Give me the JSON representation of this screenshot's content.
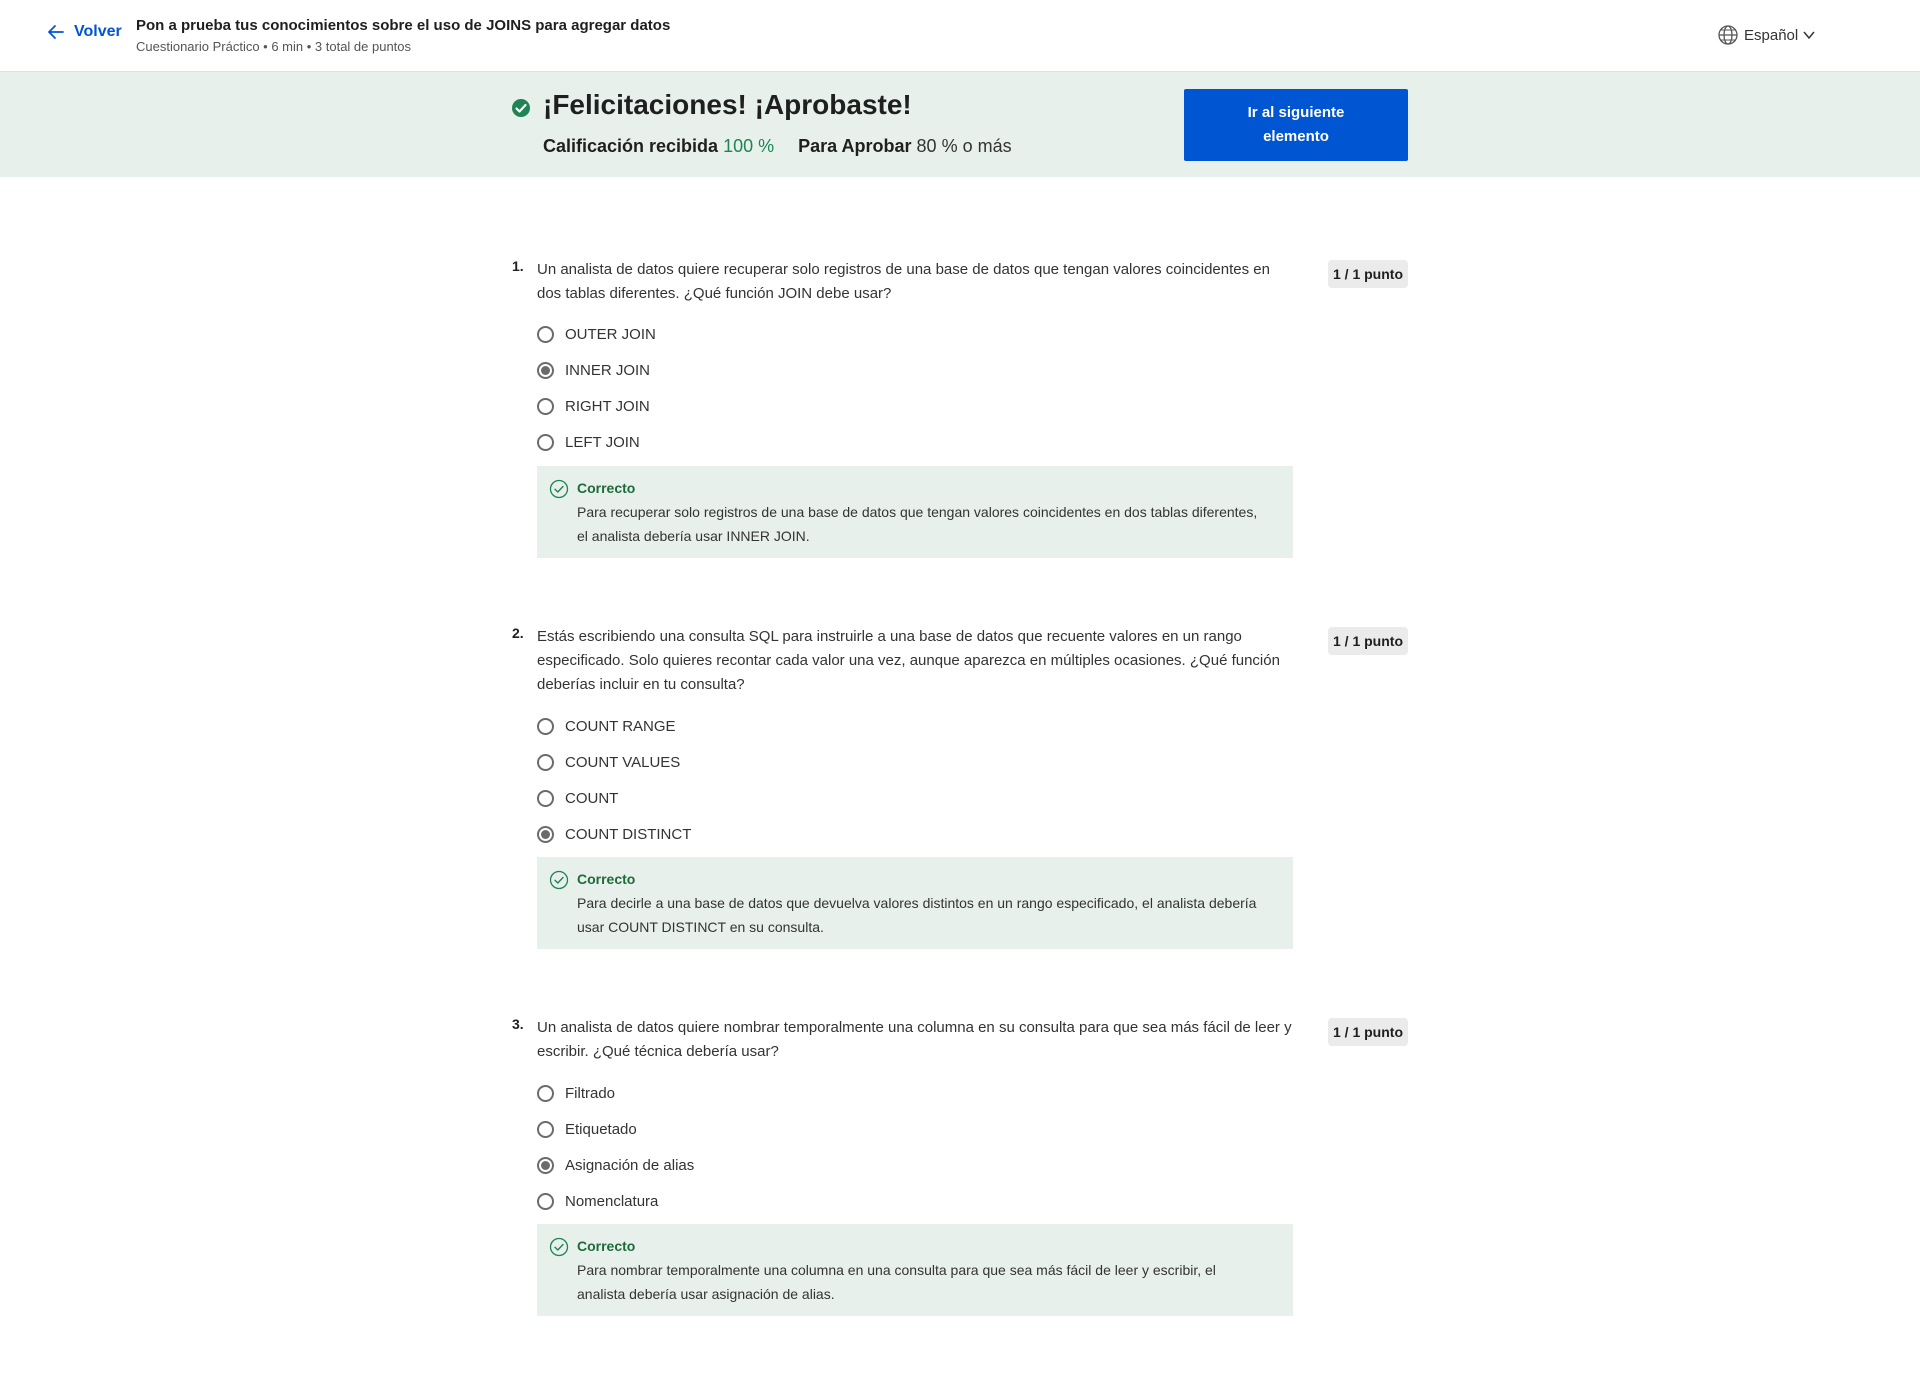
{
  "header": {
    "back_label": "Volver",
    "title": "Pon a prueba tus conocimientos sobre el uso de JOINS para agregar datos",
    "subtitle": "Cuestionario Práctico • 6 min • 3 total de puntos",
    "language": "Español"
  },
  "banner": {
    "heading": "¡Felicitaciones! ¡Aprobaste!",
    "grade_label": "Calificación recibida",
    "grade_value": "100 %",
    "pass_label": "Para Aprobar",
    "pass_value": "80 % o más",
    "next_button": "Ir al siguiente elemento"
  },
  "questions": [
    {
      "number": "1.",
      "text": "Un analista de datos quiere recuperar solo registros de una base de datos que tengan valores coincidentes en dos tablas diferentes. ¿Qué función JOIN debe usar?",
      "points": "1 / 1 punto",
      "options": [
        "OUTER JOIN",
        "INNER JOIN",
        "RIGHT JOIN",
        "LEFT JOIN"
      ],
      "selected": "INNER JOIN",
      "feedback_title": "Correcto",
      "feedback_text": "Para recuperar solo registros de una base de datos que tengan valores coincidentes en dos tablas diferentes, el analista debería usar INNER JOIN."
    },
    {
      "number": "2.",
      "text": "Estás escribiendo una consulta SQL para instruirle a una base de datos que recuente valores en un rango especificado. Solo quieres recontar cada valor una vez, aunque aparezca en múltiples ocasiones. ¿Qué función deberías incluir en tu consulta?",
      "points": "1 / 1 punto",
      "options": [
        "COUNT RANGE",
        "COUNT VALUES",
        "COUNT",
        "COUNT DISTINCT"
      ],
      "selected": "COUNT DISTINCT",
      "feedback_title": "Correcto",
      "feedback_text": "Para decirle a una base de datos que devuelva valores distintos en un rango especificado, el analista debería usar COUNT DISTINCT en su consulta."
    },
    {
      "number": "3.",
      "text": "Un analista de datos quiere nombrar temporalmente una columna en su consulta para que sea más fácil de leer y escribir. ¿Qué técnica debería usar?",
      "points": "1 / 1 punto",
      "options": [
        "Filtrado",
        "Etiquetado",
        "Asignación de alias",
        "Nomenclatura"
      ],
      "selected": "Asignación de alias",
      "feedback_title": "Correcto",
      "feedback_text": "Para nombrar temporalmente una columna en una consulta para que sea más fácil de leer y escribir, el analista debería usar asignación de alias."
    }
  ],
  "colors": {
    "accent": "#0056d2",
    "success_bg": "#e8f0ec",
    "success_text": "#1f8354"
  }
}
